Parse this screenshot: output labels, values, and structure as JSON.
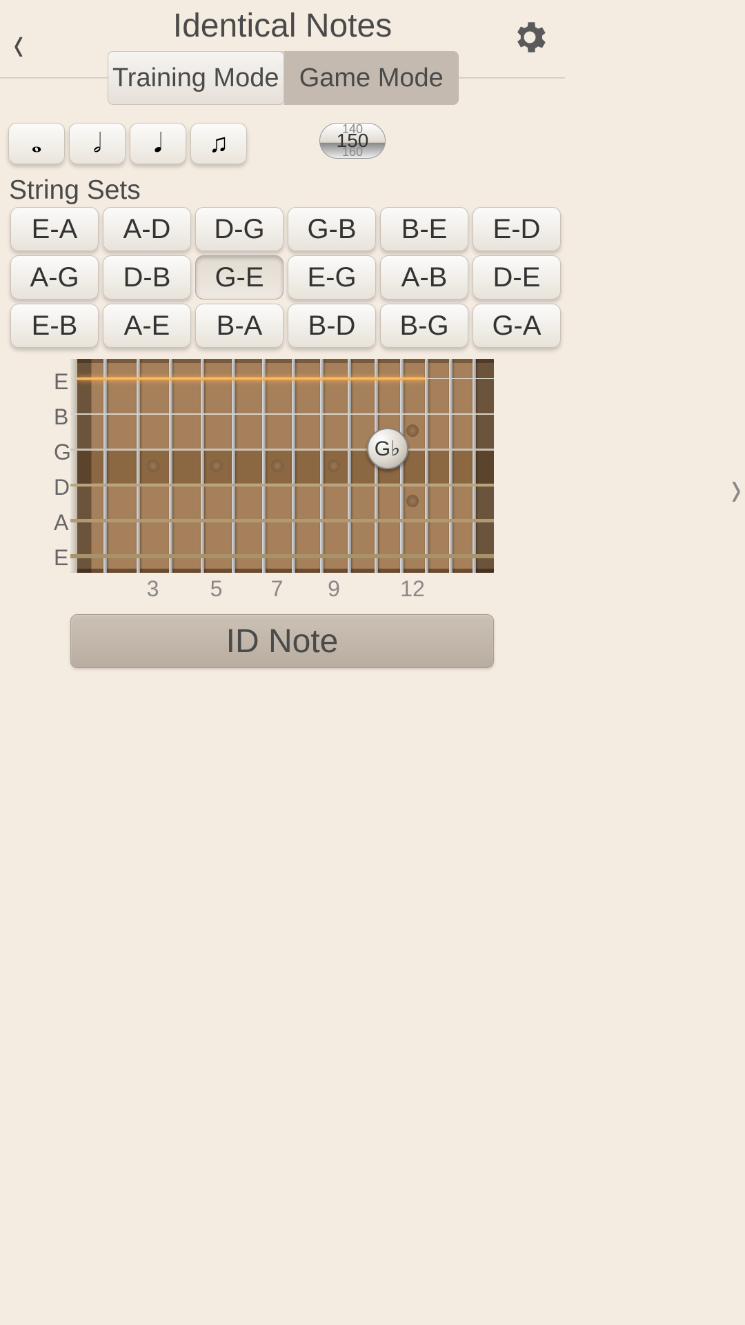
{
  "header": {
    "title": "Identical Notes",
    "back_glyph": "‹",
    "gear_name": "settings-gear-icon"
  },
  "modes": {
    "training": "Training Mode",
    "game": "Game Mode",
    "active": "training"
  },
  "note_values": [
    {
      "glyph": "𝅝",
      "name": "whole-note"
    },
    {
      "glyph": "𝅗𝅥",
      "name": "half-note"
    },
    {
      "glyph": "𝅘𝅥",
      "name": "quarter-note"
    },
    {
      "glyph": "♫",
      "name": "eighth-notes"
    }
  ],
  "tempo": {
    "prev": "140",
    "value": "150",
    "next": "160"
  },
  "string_sets": {
    "label": "String Sets",
    "items": [
      "E-A",
      "A-D",
      "D-G",
      "G-B",
      "B-E",
      "E-D",
      "A-G",
      "D-B",
      "G-E",
      "E-G",
      "A-B",
      "D-E",
      "E-B",
      "A-E",
      "B-A",
      "B-D",
      "B-G",
      "G-A"
    ],
    "selected_index": 8
  },
  "fretboard": {
    "string_labels": [
      "E",
      "B",
      "G",
      "D",
      "A",
      "E"
    ],
    "fret_numbers": [
      "3",
      "5",
      "7",
      "9",
      "12"
    ],
    "marker_label": "G♭",
    "highlight_string": "E-high"
  },
  "action": {
    "id_note": "ID Note"
  },
  "next_glyph": "›"
}
